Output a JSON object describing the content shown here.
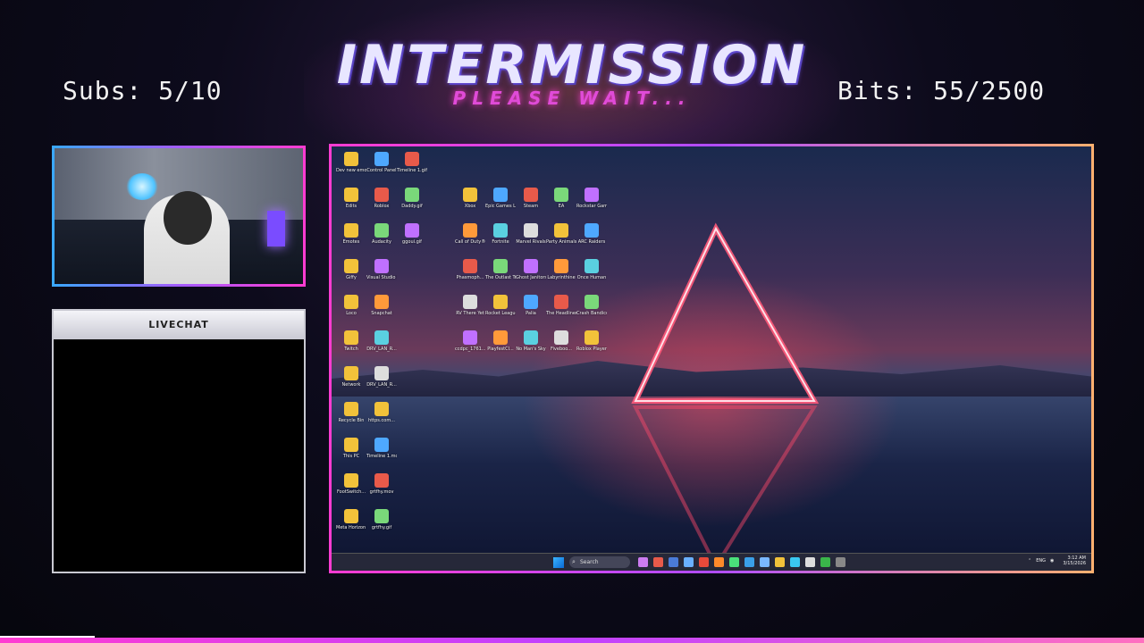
{
  "overlay": {
    "title": "INTERMISSION",
    "subtitle": "PLEASE WAIT...",
    "subs": "Subs: 5/10",
    "bits": "Bits: 55/2500",
    "chat_title": "LIVECHAT",
    "colors": {
      "accent_pink": "#ff3cd2",
      "accent_purple": "#b04cff",
      "accent_blue": "#3aa8ff"
    }
  },
  "desktop": {
    "col1": [
      "Dev new emotes",
      "Edits",
      "Emotes",
      "Giffy",
      "Loco",
      "Twitch",
      "Network",
      "Recycle Bin",
      "This PC",
      "FootSwitch...",
      "Meta Horizon Link"
    ],
    "col2": [
      "Control Panel",
      "Roblox",
      "Audacity",
      "Visual Studio Code",
      "Snapchat",
      "DRV_LAN_R...",
      "DRV_LAN_R...",
      "https.com...",
      "Timeline 1.mov",
      "grtfhy.mov",
      "grtfhy.gif"
    ],
    "col3": [
      "Timeline 1.gif",
      "Daddy.gif",
      "ggoui.gif"
    ],
    "games": [
      [
        "Xbox",
        "Epic Games Launcher",
        "Steam",
        "EA",
        "Rockstar Games..."
      ],
      [
        "Call of Duty®",
        "Fortnite",
        "Marvel Rivals",
        "Party Animals",
        "ARC Raiders"
      ],
      [
        "Phasmoph...",
        "The Outlast Trials",
        "Ghost Janitors",
        "Labyrinthine",
        "Once Human"
      ],
      [
        "RV There Yet",
        "Rocket League®",
        "Palia",
        "The Headliners",
        "Crash Bandicoot..."
      ],
      [
        "ccdpc_1761...",
        "PlayfestCl...",
        "No Man's Sky",
        "Fiveboo...",
        "Roblox Player"
      ]
    ],
    "taskbar": {
      "search": "Search",
      "lang": "ENG",
      "time": "3:12 AM",
      "date": "3/15/2026"
    }
  }
}
